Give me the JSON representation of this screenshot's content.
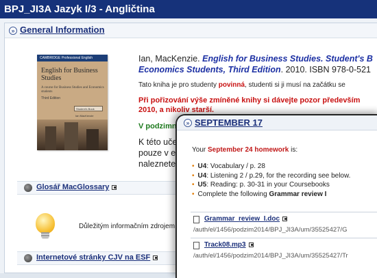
{
  "window": {
    "title": "BPJ_JI3A Jazyk I/3 - Angličtina"
  },
  "general": {
    "section_title": "General Information",
    "book": {
      "publisher_banner": "CAMBRIDGE   Professional English",
      "title": "English for Business Studies",
      "subtitle": "A course for Business Studies and Economics students",
      "edition": "Third Edition",
      "badge": "Student's Book",
      "author": "Ian MacKenzie"
    },
    "citation": {
      "author": "Ian, MacKenzie. ",
      "title_line1": "English for Business Studies. Student's B",
      "title_line2": "Economics Students, Third Edition",
      "tail": ". 2010. ISBN 978-0-521"
    },
    "note": {
      "prefix": "Tato kniha je pro studenty ",
      "emphasis": "povinná",
      "suffix": ", studenti si ji musí na začátku se"
    },
    "warning": {
      "line1": "Při pořizování výše zmíněné knihy si dávejte pozor především",
      "line2": "2010, a nikoliv starší."
    },
    "green_text": "V podzimn",
    "gray_text": [
      "K této uče",
      "pouze v el",
      "naleznete"
    ]
  },
  "glossary": {
    "link": "Glosář MacGlossary",
    "text": "Důležitým informačním zdrojem pro v"
  },
  "esf": {
    "link": "Internetové stránky CJV na ESF"
  },
  "popup": {
    "title": "SEPTEMBER 17",
    "intro_prefix": "Your ",
    "intro_emphasis": "September 24 homework",
    "intro_suffix": " is:",
    "items": [
      {
        "unit": "U4",
        "text": ": Vocabulary / p. 28"
      },
      {
        "unit": "U4",
        "text": ": Listening 2 / p.29, for the recording see below."
      },
      {
        "unit": "U5",
        "text": ": Reading: p. 30-31 in your Coursebooks"
      },
      {
        "unit": "",
        "text": "Complete the following ",
        "bold": "Grammar  review I"
      }
    ],
    "files": [
      {
        "name": "Grammar_review_I.doc",
        "path": "/auth/el/1456/podzim2014/BPJ_JI3A/um/35525427/G"
      },
      {
        "name": "Track08.mp3",
        "path": "/auth/el/1456/podzim2014/BPJ_JI3A/um/35525427/Tr"
      }
    ]
  }
}
